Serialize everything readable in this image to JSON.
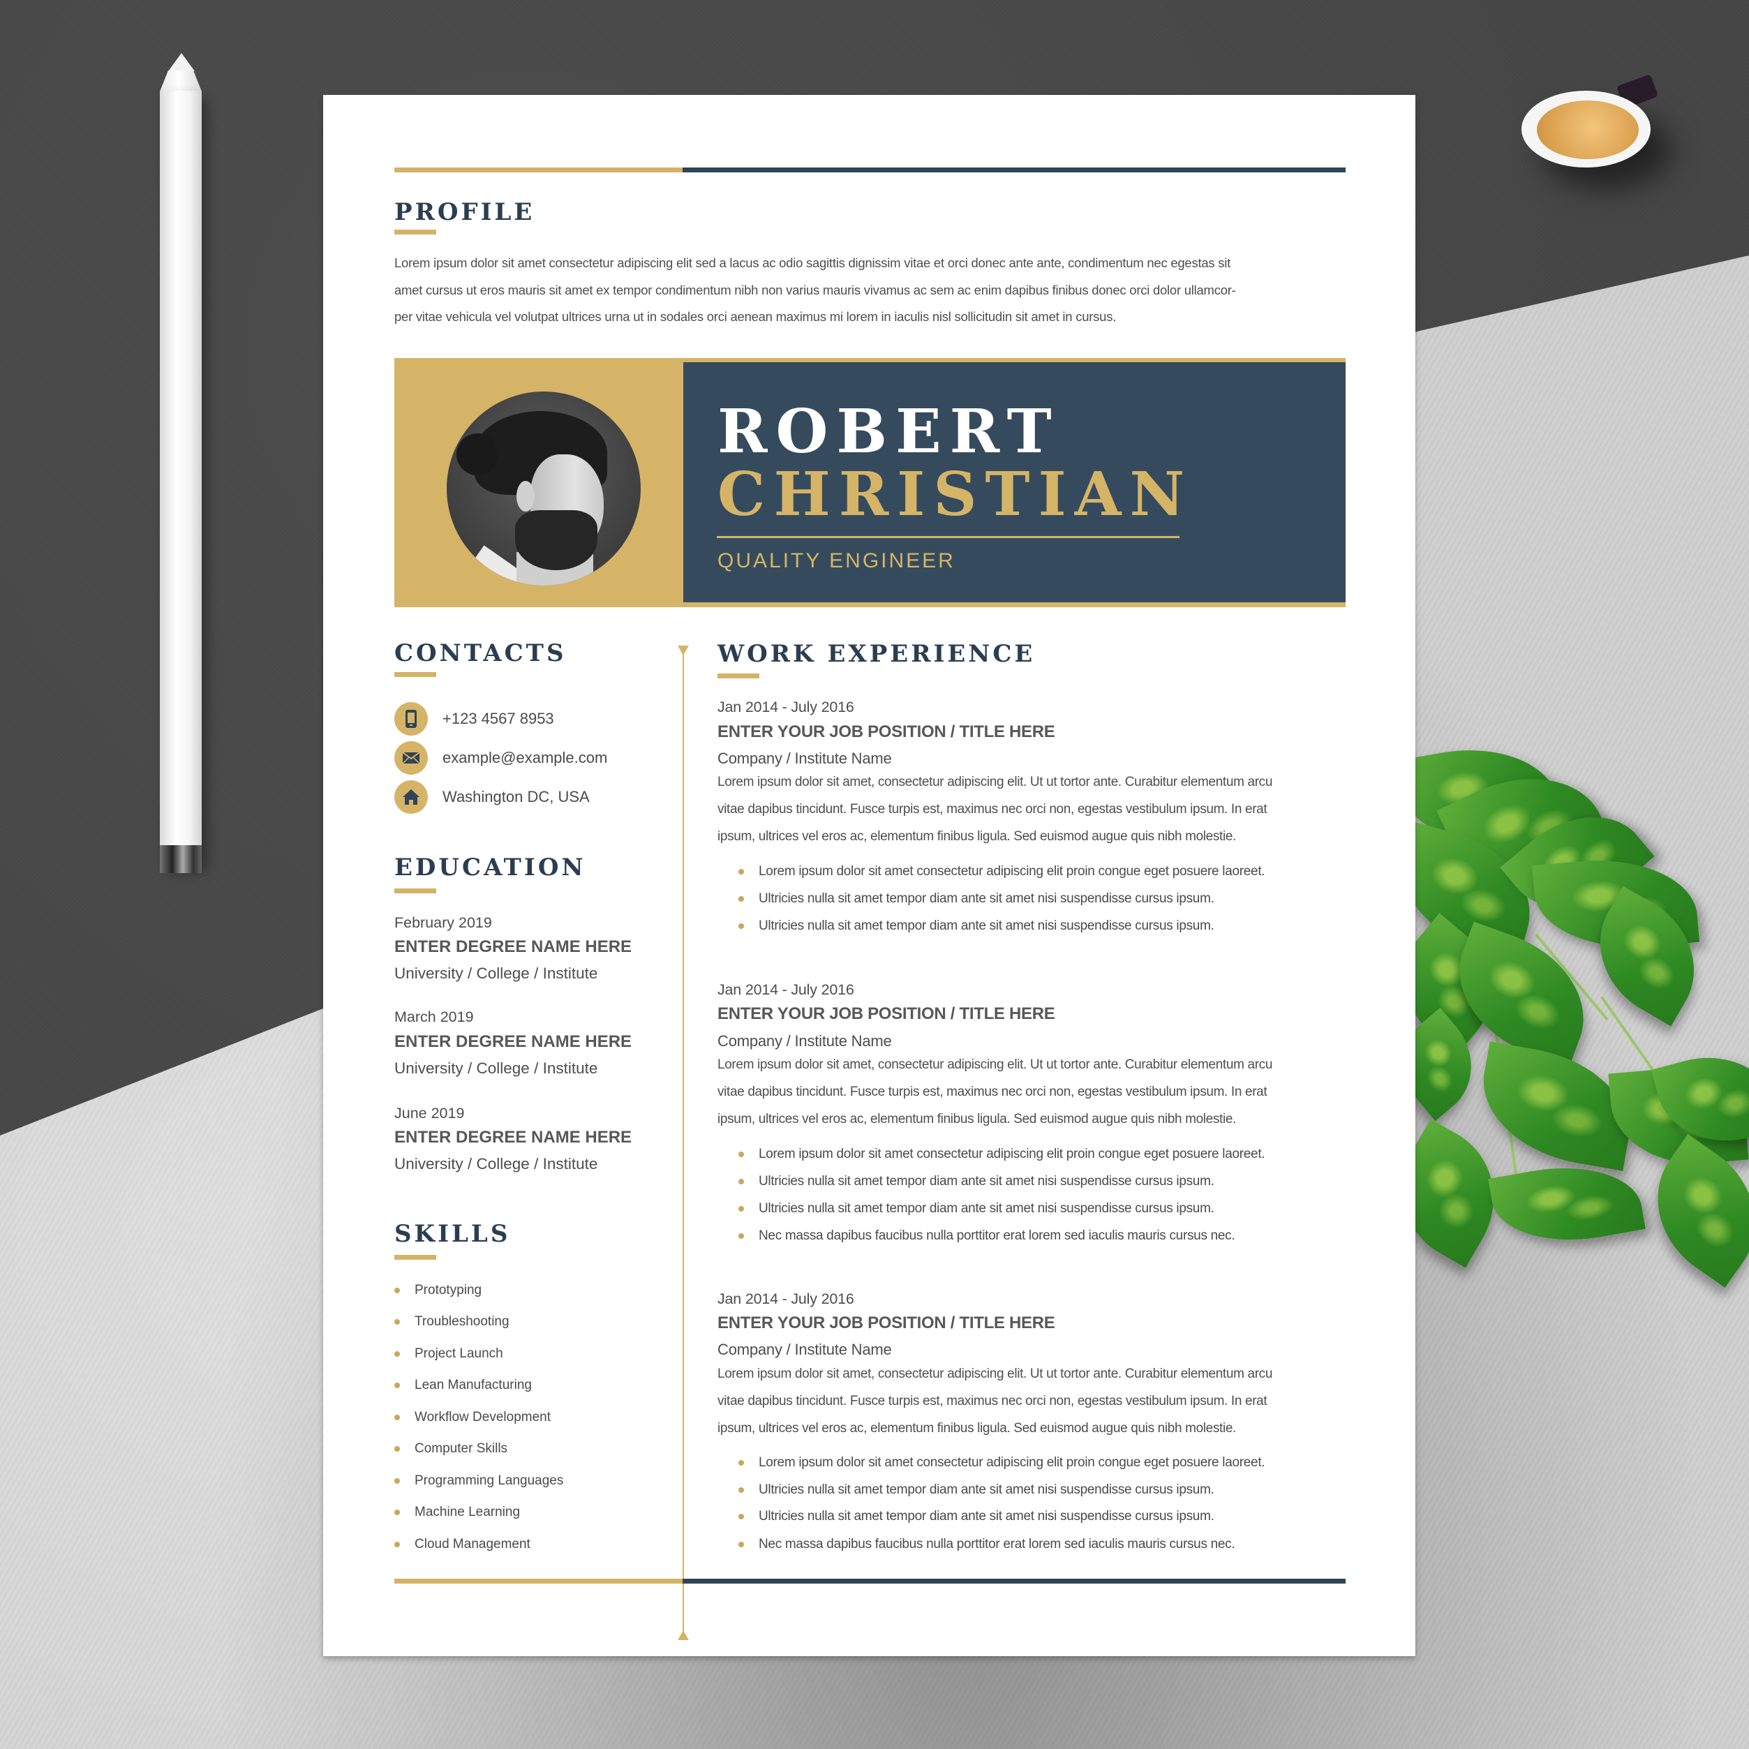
{
  "colors": {
    "gold": "#d5b468",
    "navy": "#354b5d",
    "heading": "#2b3e50",
    "body_text": "#4e4e4e"
  },
  "profile": {
    "title": "PROFILE",
    "lines": [
      "Lorem ipsum dolor sit amet consectetur adipiscing elit sed a lacus ac odio sagittis dignissim vitae et orci donec ante ante, condimentum nec egestas sit",
      "amet cursus ut eros mauris sit amet ex tempor condimentum nibh non varius mauris vivamus ac sem ac enim dapibus finibus donec orci dolor ullamcor-",
      "per vitae vehicula vel volutpat ultrices urna ut in sodales orci aenean maximus mi lorem in iaculis nisl sollicitudin sit amet in cursus."
    ]
  },
  "header": {
    "first_name": "ROBERT",
    "last_name": "CHRISTIAN",
    "job_title": "QUALITY ENGINEER",
    "photo_icon": "portrait-photo"
  },
  "contacts": {
    "title": "CONTACTS",
    "items": [
      {
        "icon": "phone-icon",
        "text": "+123 4567 8953"
      },
      {
        "icon": "envelope-icon",
        "text": "example@example.com"
      },
      {
        "icon": "home-icon",
        "text": "Washington DC, USA"
      }
    ]
  },
  "education": {
    "title": "EDUCATION",
    "items": [
      {
        "date": "February 2019",
        "degree": "ENTER DEGREE NAME HERE",
        "school": "University / College / Institute"
      },
      {
        "date": "March 2019",
        "degree": "ENTER DEGREE NAME HERE",
        "school": "University / College / Institute"
      },
      {
        "date": "June 2019",
        "degree": "ENTER DEGREE NAME HERE",
        "school": "University / College / Institute"
      }
    ]
  },
  "skills": {
    "title": "SKILLS",
    "items": [
      "Prototyping",
      "Troubleshooting",
      "Project Launch",
      "Lean Manufacturing",
      "Workflow Development",
      "Computer Skills",
      "Programming Languages",
      "Machine Learning",
      "Cloud Management"
    ]
  },
  "work": {
    "title": "WORK  EXPERIENCE",
    "jobs": [
      {
        "date": "Jan 2014 - July 2016",
        "title": "ENTER YOUR JOB POSITION / TITLE HERE",
        "company": "Company / Institute Name",
        "description": [
          "Lorem ipsum dolor sit amet, consectetur adipiscing elit. Ut ut tortor ante. Curabitur elementum arcu",
          "vitae dapibus tincidunt. Fusce turpis est, maximus nec orci non, egestas vestibulum ipsum. In erat",
          "ipsum, ultrices vel eros ac, elementum finibus ligula. Sed euismod augue quis nibh molestie."
        ],
        "bullets": [
          "Lorem ipsum dolor sit amet consectetur adipiscing elit proin congue eget posuere laoreet.",
          "Ultricies nulla sit amet tempor diam ante sit amet nisi suspendisse cursus ipsum.",
          "Ultricies nulla sit amet tempor diam ante sit amet nisi suspendisse cursus ipsum."
        ]
      },
      {
        "date": "Jan 2014 - July 2016",
        "title": "ENTER YOUR JOB POSITION / TITLE HERE",
        "company": "Company / Institute Name",
        "description": [
          "Lorem ipsum dolor sit amet, consectetur adipiscing elit. Ut ut tortor ante. Curabitur elementum arcu",
          "vitae dapibus tincidunt. Fusce turpis est, maximus nec orci non, egestas vestibulum ipsum. In erat",
          "ipsum, ultrices vel eros ac, elementum finibus ligula. Sed euismod augue quis nibh molestie."
        ],
        "bullets": [
          "Lorem ipsum dolor sit amet consectetur adipiscing elit proin congue eget posuere laoreet.",
          "Ultricies nulla sit amet tempor diam ante sit amet nisi suspendisse cursus ipsum.",
          "Ultricies nulla sit amet tempor diam ante sit amet nisi suspendisse cursus ipsum.",
          "Nec massa dapibus faucibus nulla porttitor erat lorem sed iaculis mauris cursus nec."
        ]
      },
      {
        "date": "Jan 2014 - July 2016",
        "title": "ENTER YOUR JOB POSITION / TITLE HERE",
        "company": "Company / Institute Name",
        "description": [
          "Lorem ipsum dolor sit amet, consectetur adipiscing elit. Ut ut tortor ante. Curabitur elementum arcu",
          "vitae dapibus tincidunt. Fusce turpis est, maximus nec orci non, egestas vestibulum ipsum. In erat",
          "ipsum, ultrices vel eros ac, elementum finibus ligula. Sed euismod augue quis nibh molestie."
        ],
        "bullets": [
          "Lorem ipsum dolor sit amet consectetur adipiscing elit proin congue eget posuere laoreet.",
          "Ultricies nulla sit amet tempor diam ante sit amet nisi suspendisse cursus ipsum.",
          "Ultricies nulla sit amet tempor diam ante sit amet nisi suspendisse cursus ipsum.",
          "Nec massa dapibus faucibus nulla porttitor erat lorem sed iaculis mauris cursus nec."
        ]
      }
    ]
  },
  "scene": {
    "objects": [
      "pencil",
      "coffee-cup",
      "pothos-plant"
    ]
  }
}
